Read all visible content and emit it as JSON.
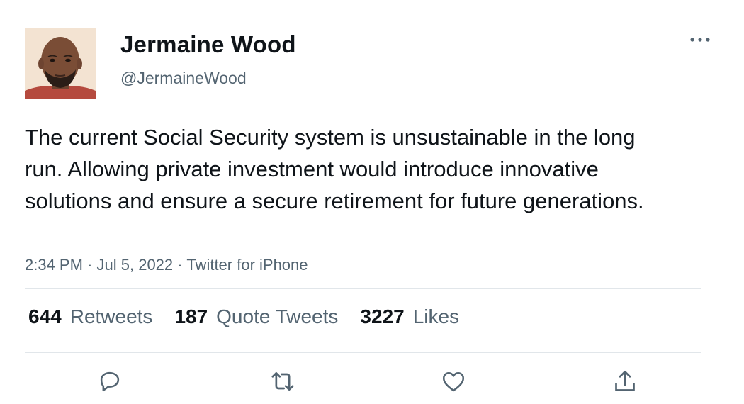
{
  "user": {
    "display_name": "Jermaine Wood",
    "handle": "@JermaineWood",
    "avatar_icon": "user-avatar-photo"
  },
  "menu": {
    "more_icon": "more-horizontal-icon"
  },
  "tweet": {
    "text": "The current Social Security system is unsustainable in the long run. Allowing private investment would introduce innovative solutions and ensure a secure retirement for future generations.",
    "time": "2:34 PM",
    "date": "Jul 5, 2022",
    "source": "Twitter for iPhone",
    "separator": "·"
  },
  "stats": {
    "retweets_count": "644",
    "retweets_label": "Retweets",
    "quotes_count": "187",
    "quotes_label": "Quote Tweets",
    "likes_count": "3227",
    "likes_label": "Likes"
  },
  "actions": {
    "reply_icon": "reply-icon",
    "retweet_icon": "retweet-icon",
    "like_icon": "heart-icon",
    "share_icon": "share-icon"
  },
  "colors": {
    "text_primary": "#0f1419",
    "text_secondary": "#536471",
    "divider": "#e1e6ea",
    "icon": "#536471"
  }
}
